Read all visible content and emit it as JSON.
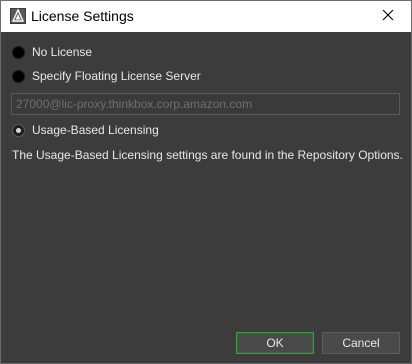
{
  "window": {
    "title": "License Settings",
    "app_icon": "deadline-logo-icon",
    "close_icon": "close-icon"
  },
  "options": [
    {
      "label": "No License",
      "checked": false
    },
    {
      "label": "Specify Floating License Server",
      "checked": false
    },
    {
      "label": "Usage-Based Licensing",
      "checked": true
    }
  ],
  "server_field": {
    "value": "27000@lic-proxy.thinkbox.corp.amazon.com",
    "disabled": true
  },
  "info_text": "The Usage-Based Licensing settings are found in the Repository Options.",
  "buttons": {
    "ok_label": "OK",
    "cancel_label": "Cancel"
  },
  "colors": {
    "dialog_bg": "#3c3c3c",
    "ok_border": "#3e9a3e"
  }
}
